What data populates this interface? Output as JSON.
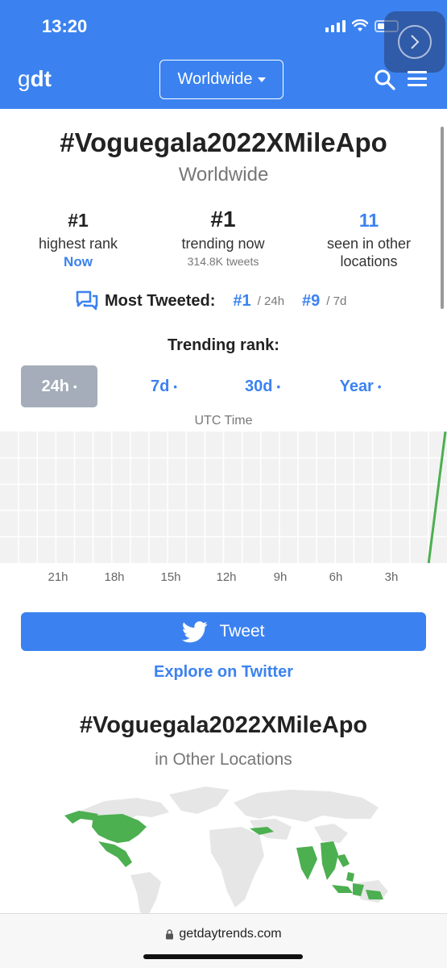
{
  "status": {
    "time": "13:20"
  },
  "header": {
    "logo": "gdt",
    "location_select": "Worldwide"
  },
  "trend": {
    "hashtag": "#Voguegala2022XMileApo",
    "location": "Worldwide"
  },
  "stats": {
    "highest": {
      "value": "#1",
      "label": "highest rank",
      "sub": "Now"
    },
    "now": {
      "value": "#1",
      "label": "trending now",
      "sub": "314.8K tweets"
    },
    "other": {
      "value": "11",
      "label1": "seen in other",
      "label2": "locations"
    }
  },
  "most_tweeted": {
    "label": "Most Tweeted:",
    "r1": "#1",
    "r1_period": "/ 24h",
    "r2": "#9",
    "r2_period": "/ 7d"
  },
  "trending_rank_label": "Trending rank:",
  "tabs": [
    {
      "label": "24h",
      "dot": "•",
      "active": true
    },
    {
      "label": "7d",
      "dot": "•",
      "active": false
    },
    {
      "label": "30d",
      "dot": "•",
      "active": false
    },
    {
      "label": "Year",
      "dot": "•",
      "active": false
    }
  ],
  "chart_data": {
    "type": "line",
    "title": "",
    "xlabel": "UTC Time",
    "ylabel": "",
    "x_ticks": [
      "21h",
      "18h",
      "15h",
      "12h",
      "9h",
      "6h",
      "3h"
    ],
    "grid": true,
    "series": [
      {
        "color": "#4caf50",
        "x": [
          -0.9,
          0
        ],
        "y": [
          0.0,
          1.0
        ]
      }
    ]
  },
  "actions": {
    "tweet": "Tweet",
    "explore": "Explore on Twitter"
  },
  "other_locations": {
    "hashtag": "#Voguegala2022XMileApo",
    "subtitle": "in Other Locations"
  },
  "browser": {
    "url": "getdaytrends.com"
  },
  "colors": {
    "brand": "#3b82f0",
    "trend_green": "#4caf50",
    "map_land": "#e4e4e4"
  }
}
